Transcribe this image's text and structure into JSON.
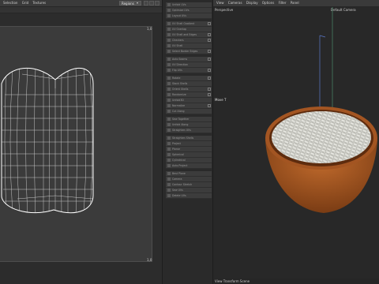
{
  "uv_editor": {
    "menu": [
      "Selection",
      "Grid",
      "Textures"
    ],
    "dropdown_value": "Regions",
    "corner_top": "1,0",
    "corner_bottom": "1,0"
  },
  "middle_panel": {
    "rows": [
      "Unfold UVs",
      "Optimize UVs",
      "Layout UVs",
      "UV Shell Gradient",
      "UV Overlap",
      "UV Shell and Edges",
      "Checkers",
      "UV Shell",
      "Select Border Edges",
      "Auto Seams",
      "UV Direction",
      "Flip UVs",
      "Rotate",
      "Stack Shells",
      "Orient Shells",
      "Randomize",
      "Unfold3D",
      "Normalize",
      "Cut Along",
      "Sew Together",
      "Unfold Along",
      "Straighten UVs",
      "Straighten Shells",
      "Project",
      "Planar",
      "Spherical",
      "Cylindrical",
      "Auto Project",
      "Best Plane",
      "Camera",
      "Contour Stretch",
      "Sew UVs",
      "Delete UVs"
    ],
    "separators_after": [
      2,
      8,
      11,
      18,
      21,
      27
    ]
  },
  "viewport": {
    "menu": [
      "View",
      "Cameras",
      "Display",
      "Options",
      "Filter",
      "Panel"
    ],
    "camera_label": "Perspective",
    "default_camera": "Default Camera",
    "move_label": "Move T",
    "status": "View Transform Scene"
  },
  "colors": {
    "uv_wire": "#ffffff",
    "uv_grid_bg": "#3b3b3b",
    "bowl": "#a85a24",
    "rice": "#d8d8d2"
  }
}
